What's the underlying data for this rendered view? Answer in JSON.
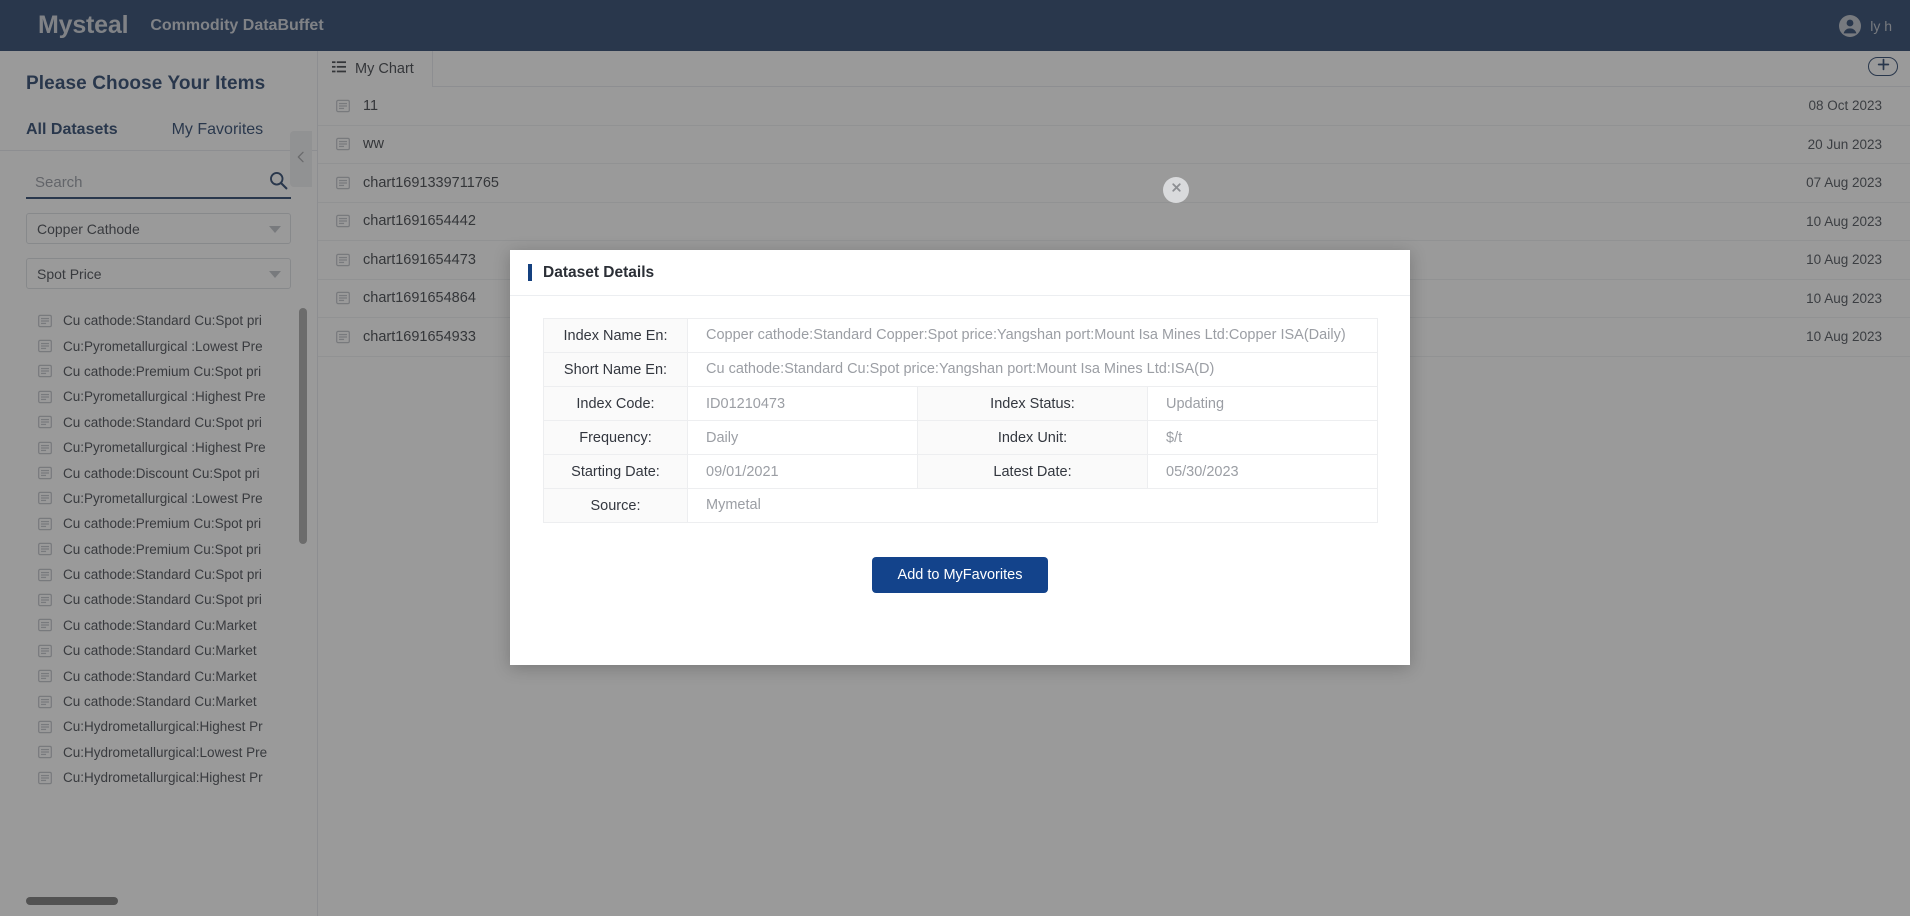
{
  "topbar": {
    "brand": "Mysteal",
    "product": "Commodity DataBuffet",
    "user_name": "ly h",
    "avatar_icon": "user-circle-icon"
  },
  "sidebar": {
    "title": "Please Choose Your Items",
    "tabs": [
      {
        "label": "All Datasets",
        "active": true
      },
      {
        "label": "My Favorites",
        "active": false
      }
    ],
    "search": {
      "value": "",
      "placeholder": "Search",
      "icon": "search-icon"
    },
    "filters": [
      {
        "name": "commodity-filter",
        "value": "Copper Cathode"
      },
      {
        "name": "price-type-filter",
        "value": "Spot Price"
      }
    ],
    "collapse_icon": "chevron-left-icon",
    "datasets": [
      "Cu cathode:Standard Cu:Spot pri",
      "Cu:Pyrometallurgical :Lowest Pre",
      "Cu cathode:Premium Cu:Spot pri",
      "Cu:Pyrometallurgical :Highest Pre",
      "Cu cathode:Standard Cu:Spot pri",
      "Cu:Pyrometallurgical :Highest Pre",
      "Cu cathode:Discount Cu:Spot pri",
      "Cu:Pyrometallurgical :Lowest Pre",
      "Cu cathode:Premium Cu:Spot pri",
      "Cu cathode:Premium Cu:Spot pri",
      "Cu cathode:Standard Cu:Spot pri",
      "Cu cathode:Standard Cu:Spot pri",
      "Cu cathode:Standard Cu:Market",
      "Cu cathode:Standard Cu:Market",
      "Cu cathode:Standard Cu:Market",
      "Cu cathode:Standard Cu:Market",
      "Cu:Hydrometallurgical:Highest Pr",
      "Cu:Hydrometallurgical:Lowest Pre",
      "Cu:Hydrometallurgical:Highest Pr"
    ]
  },
  "main": {
    "tab": {
      "label": "My Chart",
      "icon": "list-icon"
    },
    "add_button_icon": "plus-icon",
    "rows": [
      {
        "name": "11",
        "date": "08 Oct 2023"
      },
      {
        "name": "ww",
        "date": "20 Jun 2023"
      },
      {
        "name": "chart1691339711765",
        "date": "07 Aug 2023"
      },
      {
        "name": "chart1691654442",
        "date": "10 Aug 2023"
      },
      {
        "name": "chart1691654473",
        "date": "10 Aug 2023"
      },
      {
        "name": "chart1691654864",
        "date": "10 Aug 2023"
      },
      {
        "name": "chart1691654933",
        "date": "10 Aug 2023"
      }
    ]
  },
  "modal": {
    "title": "Dataset Details",
    "close_icon": "close-icon",
    "fields": {
      "index_name_en_label": "Index Name En:",
      "index_name_en_value": "Copper cathode:Standard Copper:Spot price:Yangshan port:Mount Isa Mines Ltd:Copper ISA(Daily)",
      "short_name_en_label": "Short Name En:",
      "short_name_en_value": "Cu cathode:Standard Cu:Spot price:Yangshan port:Mount Isa Mines Ltd:ISA(D)",
      "index_code_label": "Index Code:",
      "index_code_value": "ID01210473",
      "index_status_label": "Index Status:",
      "index_status_value": "Updating",
      "frequency_label": "Frequency:",
      "frequency_value": "Daily",
      "index_unit_label": "Index Unit:",
      "index_unit_value": "$/t",
      "starting_date_label": "Starting Date:",
      "starting_date_value": "09/01/2021",
      "latest_date_label": "Latest Date:",
      "latest_date_value": "05/30/2023",
      "source_label": "Source:",
      "source_value": "Mymetal"
    },
    "primary_button": "Add to MyFavorites"
  },
  "colors": {
    "brand_navy": "#13315c",
    "accent_blue": "#14407f",
    "button_blue": "#13438b",
    "overlay": "#3d3d3d"
  }
}
